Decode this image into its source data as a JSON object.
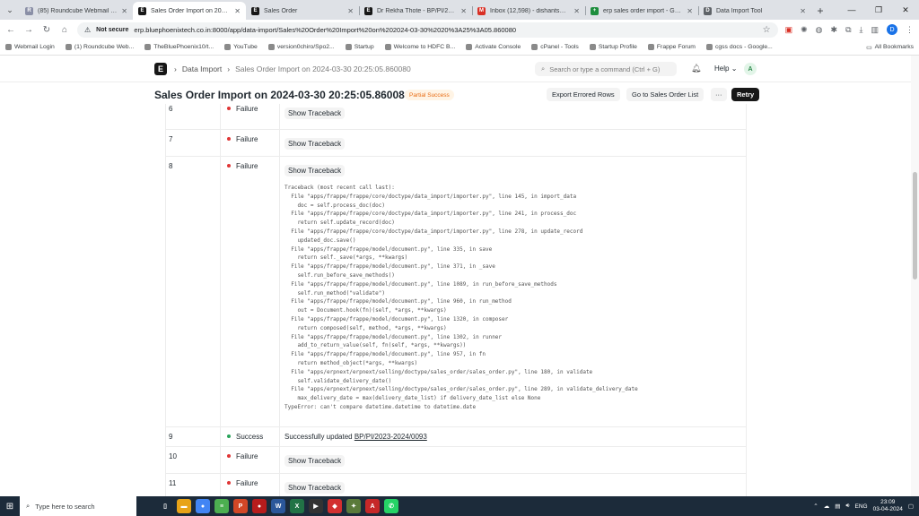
{
  "browser": {
    "tabs": [
      {
        "title": "(85) Roundcube Webmail :: Inbox",
        "icon": "roundcube-icon",
        "color": "#8a8fa6",
        "glyph": "R"
      },
      {
        "title": "Sales Order Import on 2024-03-30",
        "icon": "frappe-icon",
        "color": "#171717",
        "glyph": "E",
        "active": true
      },
      {
        "title": "Sales Order",
        "icon": "frappe-icon",
        "color": "#171717",
        "glyph": "E"
      },
      {
        "title": "Dr Rekha Thote - BP/PI/2023-24",
        "icon": "frappe-icon",
        "color": "#171717",
        "glyph": "E"
      },
      {
        "title": "Inbox (12,598) - dishantshah1",
        "icon": "gmail-icon",
        "color": "#d93025",
        "glyph": "M"
      },
      {
        "title": "erp sales order import - Google",
        "icon": "google-sheets-icon",
        "color": "#1e8e3e",
        "glyph": "+"
      },
      {
        "title": "Data Import Tool",
        "icon": "page-icon",
        "color": "#5f6368",
        "glyph": "D"
      }
    ],
    "not_secure": "Not secure",
    "url": "erp.bluephoenixtech.co.in:8000/app/data-import/Sales%20Order%20Import%20on%202024-03-30%2020%3A25%3A05.860080",
    "bookmarks": [
      "Webmail Login",
      "(1) Roundcube Web...",
      "TheBluePhoenix10/t...",
      "YouTube",
      "version0chiro/Spo2...",
      "Startup",
      "Welcome to HDFC B...",
      "Activate Console",
      "cPanel - Tools",
      "Startup Profile",
      "Frappe Forum",
      "cgss docs - Google..."
    ],
    "all_bookmarks": "All Bookmarks"
  },
  "app": {
    "logo": "E",
    "breadcrumb": [
      "Data Import",
      "Sales Order Import on 2024-03-30 20:25:05.860080"
    ],
    "search_placeholder": "Search or type a command (Ctrl + G)",
    "help": "Help",
    "avatar": "A",
    "title": "Sales Order Import on 2024-03-30 20:25:05.860080",
    "status": "Partial Success",
    "buttons": {
      "export_errored": "Export Errored Rows",
      "go_to_list": "Go to Sales Order List",
      "more": "···",
      "retry": "Retry"
    }
  },
  "import_log": {
    "show_traceback": "Show Traceback",
    "rows": [
      {
        "idx": "6",
        "status": "Failure"
      },
      {
        "idx": "7",
        "status": "Failure"
      },
      {
        "idx": "8",
        "status": "Failure"
      },
      {
        "idx": "9",
        "status": "Success",
        "message": "Successfully updated",
        "link": "BP/PI/2023-2024/0093"
      },
      {
        "idx": "10",
        "status": "Failure"
      },
      {
        "idx": "11",
        "status": "Failure"
      }
    ],
    "traceback": "Traceback (most recent call last):\n  File \"apps/frappe/frappe/core/doctype/data_import/importer.py\", line 145, in import_data\n    doc = self.process_doc(doc)\n  File \"apps/frappe/frappe/core/doctype/data_import/importer.py\", line 241, in process_doc\n    return self.update_record(doc)\n  File \"apps/frappe/frappe/core/doctype/data_import/importer.py\", line 278, in update_record\n    updated_doc.save()\n  File \"apps/frappe/frappe/model/document.py\", line 335, in save\n    return self._save(*args, **kwargs)\n  File \"apps/frappe/frappe/model/document.py\", line 371, in _save\n    self.run_before_save_methods()\n  File \"apps/frappe/frappe/model/document.py\", line 1089, in run_before_save_methods\n    self.run_method(\"validate\")\n  File \"apps/frappe/frappe/model/document.py\", line 960, in run_method\n    out = Document.hook(fn)(self, *args, **kwargs)\n  File \"apps/frappe/frappe/model/document.py\", line 1320, in composer\n    return composed(self, method, *args, **kwargs)\n  File \"apps/frappe/frappe/model/document.py\", line 1302, in runner\n    add_to_return_value(self, fn(self, *args, **kwargs))\n  File \"apps/frappe/frappe/model/document.py\", line 957, in fn\n    return method_object(*args, **kwargs)\n  File \"apps/erpnext/erpnext/selling/doctype/sales_order/sales_order.py\", line 180, in validate\n    self.validate_delivery_date()\n  File \"apps/erpnext/erpnext/selling/doctype/sales_order/sales_order.py\", line 289, in validate_delivery_date\n    max_delivery_date = max(delivery_date_list) if delivery_date_list else None\nTypeError: can't compare datetime.datetime to datetime.date"
  },
  "taskbar": {
    "search": "Type here to search",
    "apps": [
      {
        "name": "task-view-icon",
        "color": "#1c2b3a",
        "glyph": "▯"
      },
      {
        "name": "file-explorer-icon",
        "color": "#e8a317",
        "glyph": "▬"
      },
      {
        "name": "chrome-icon",
        "color": "#4285f4",
        "glyph": "●"
      },
      {
        "name": "notepad-icon",
        "color": "#4caf50",
        "glyph": "≡"
      },
      {
        "name": "powerpoint-icon",
        "color": "#d24726",
        "glyph": "P"
      },
      {
        "name": "record-icon",
        "color": "#b71c1c",
        "glyph": "●"
      },
      {
        "name": "word-icon",
        "color": "#2b579a",
        "glyph": "W"
      },
      {
        "name": "excel-icon",
        "color": "#217346",
        "glyph": "X"
      },
      {
        "name": "media-player-icon",
        "color": "#333333",
        "glyph": "▶"
      },
      {
        "name": "anydesk-icon",
        "color": "#d32f2f",
        "glyph": "◆"
      },
      {
        "name": "git-icon",
        "color": "#5a7a3a",
        "glyph": "✦"
      },
      {
        "name": "acrobat-icon",
        "color": "#c62828",
        "glyph": "A"
      },
      {
        "name": "whatsapp-icon",
        "color": "#25d366",
        "glyph": "✆"
      }
    ],
    "lang": "ENG",
    "time": "23:09",
    "date": "03-04-2024"
  }
}
